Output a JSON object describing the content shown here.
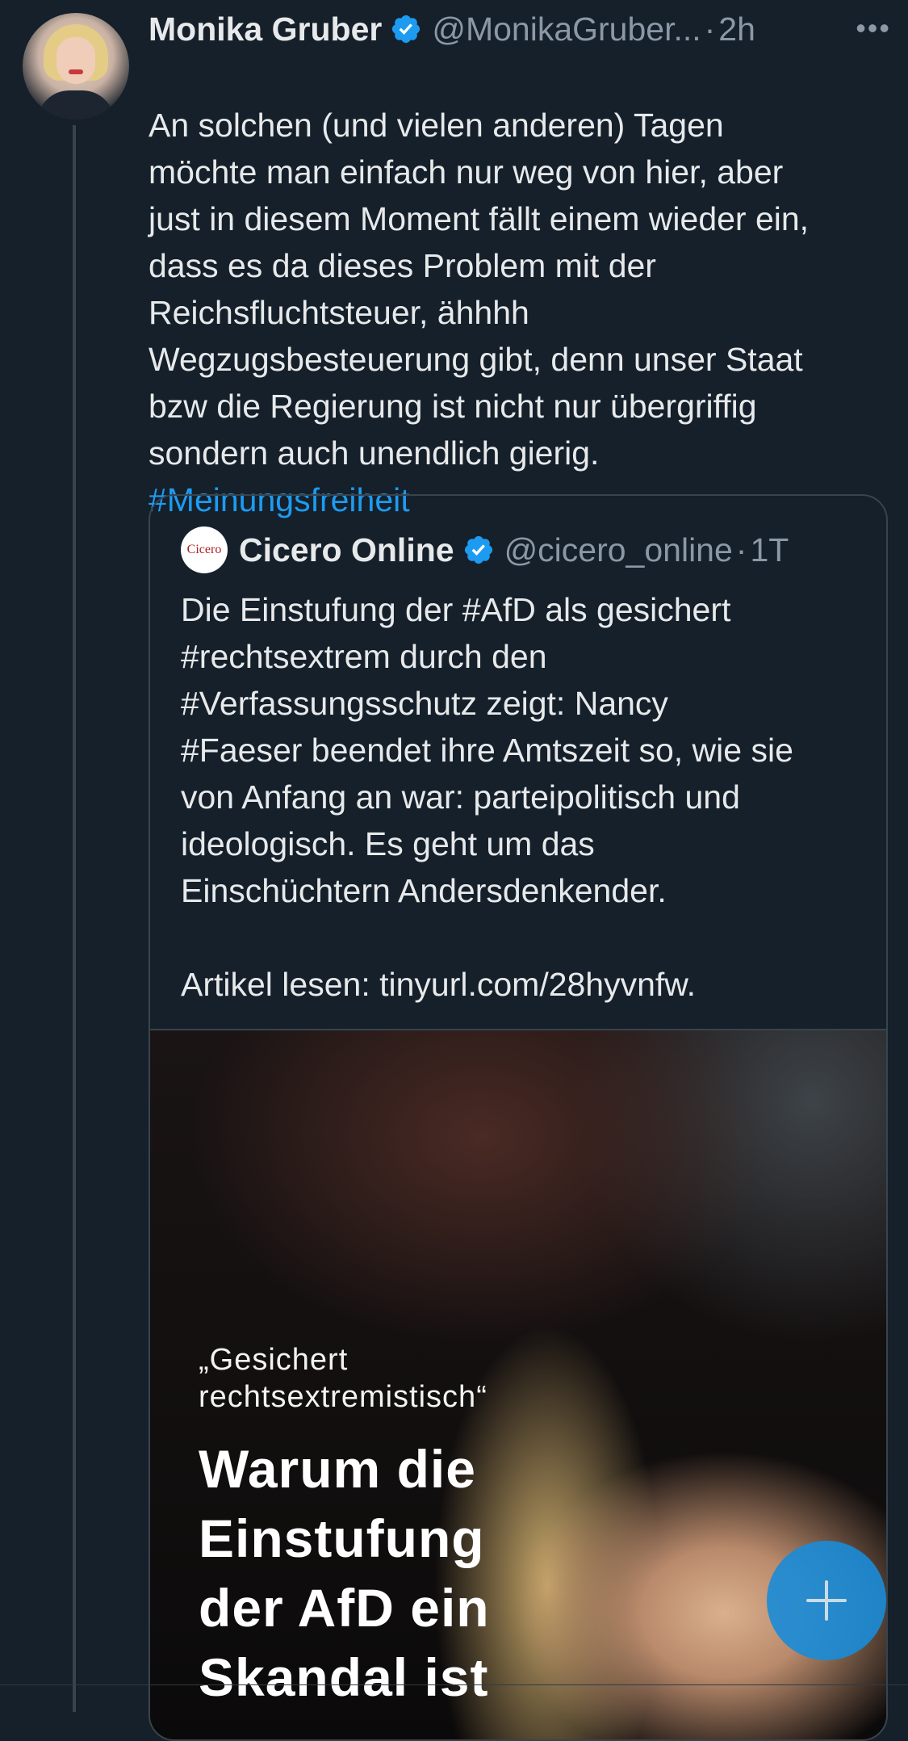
{
  "tweet": {
    "author_name": "Monika Gruber",
    "author_handle": "@MonikaGruber...",
    "separator": "·",
    "time": "2h",
    "more": "•••",
    "text": "An solchen (und vielen anderen) Tagen\nmöchte man einfach nur weg von hier, aber\njust in diesem Moment fällt einem wieder ein,\ndass es da dieses Problem mit der\nReichsfluchtsteuer, ähhhh\nWegzugsbesteuerung gibt, denn unser Staat\nbzw die Regierung ist nicht nur übergriffig\nsondern auch unendlich gierig.",
    "hashtag": "#Meinungsfreiheit"
  },
  "quote": {
    "avatar_text": "Cicero",
    "author_name": "Cicero Online",
    "author_handle": "@cicero_online",
    "separator": "·",
    "time": "1T",
    "text": "Die Einstufung der #AfD als gesichert\n#rechtsextrem durch den\n#Verfassungsschutz zeigt: Nancy\n#Faeser beendet ihre Amtszeit so, wie sie\nvon Anfang an war: parteipolitisch und\nideologisch. Es geht um das\nEinschüchtern Andersdenkender.\n\nArtikel lesen: tinyurl.com/28hyvnfw.",
    "image": {
      "subtitle": "„Gesichert\nrechtsextremistisch“",
      "title": "Warum die\nEinstufung\nder AfD ein\nSkandal ist"
    }
  },
  "icons": {
    "verified": "verified-badge-icon",
    "compose": "plus-icon"
  },
  "colors": {
    "background": "#15202b",
    "text": "#e7e9ea",
    "secondary": "#8b98a5",
    "accent": "#1d9bf0",
    "border": "#38444d"
  }
}
